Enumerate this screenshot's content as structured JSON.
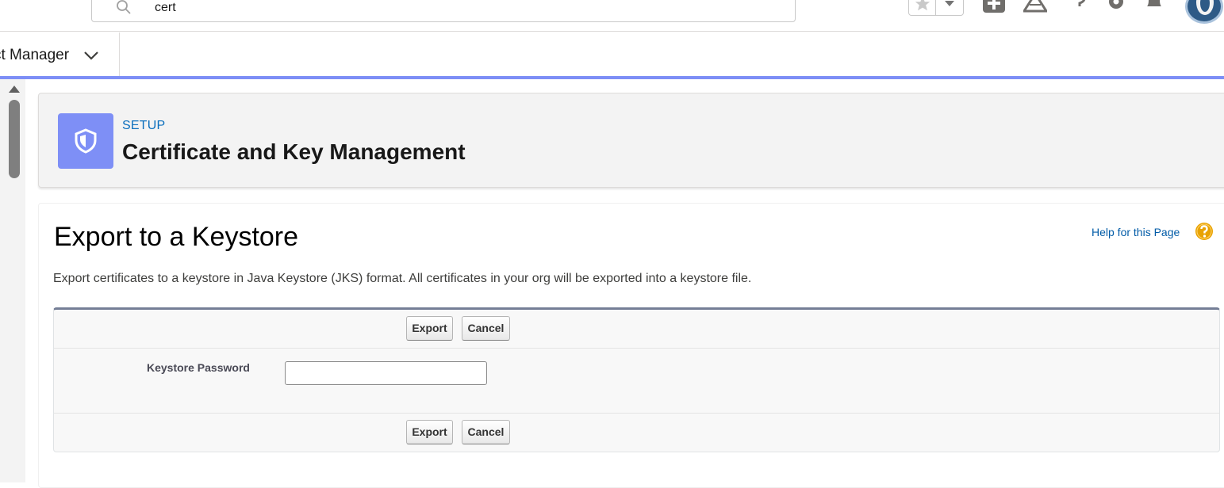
{
  "header": {
    "search_value": "cert",
    "icons": [
      "search-icon",
      "star-icon",
      "chevron-down-icon",
      "add-icon",
      "trailhead-icon",
      "help-icon",
      "gear-icon",
      "bell-icon",
      "avatar"
    ]
  },
  "app_nav": {
    "app_name": "ct Manager"
  },
  "page_header": {
    "eyebrow": "SETUP",
    "title": "Certificate and Key Management"
  },
  "main": {
    "title": "Export to a Keystore",
    "help_link": "Help for this Page",
    "description": "Export certificates to a keystore in Java Keystore (JKS) format. All certificates in your org will be exported into a keystore file.",
    "buttons": {
      "export": "Export",
      "cancel": "Cancel"
    },
    "form": {
      "keystore_password_label": "Keystore Password",
      "keystore_password_value": ""
    }
  },
  "colors": {
    "accent_bar": "#7d8ef6",
    "setup_icon_bg": "#7e8ff6",
    "link": "#015ba7",
    "help_icon": "#e8a202"
  }
}
